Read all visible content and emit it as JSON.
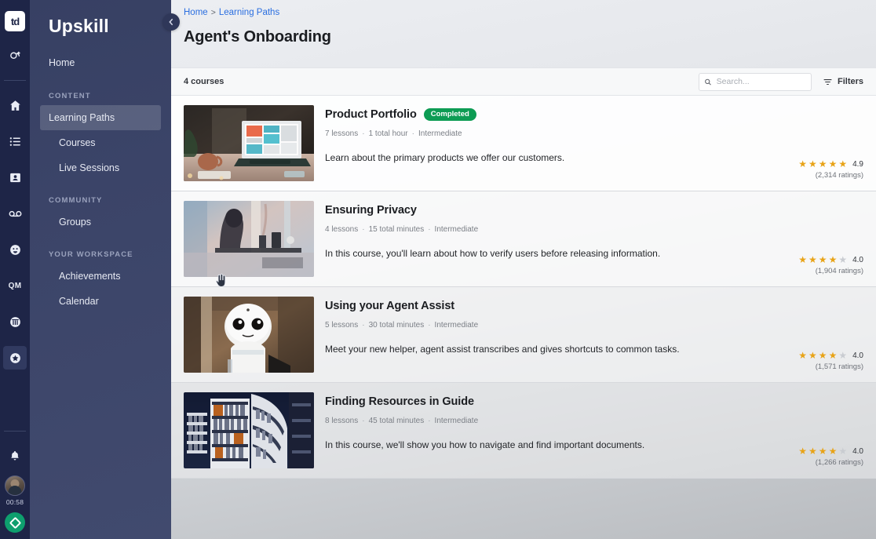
{
  "rail": {
    "logo_text": "td",
    "icons": [
      {
        "name": "messages-icon"
      },
      {
        "name": "home-icon"
      },
      {
        "name": "list-icon"
      },
      {
        "name": "contact-card-icon"
      },
      {
        "name": "voicemail-icon"
      },
      {
        "name": "smiley-icon"
      },
      {
        "name": "qm-icon",
        "label": "QM"
      },
      {
        "name": "building-icon"
      },
      {
        "name": "star-badge-icon"
      }
    ],
    "bell": "notifications-icon",
    "timer": "00:58",
    "status_icon": "diamond-icon"
  },
  "nav": {
    "brand": "Upskill",
    "home_label": "Home",
    "collapse_label": "‹",
    "groups": [
      {
        "title": "CONTENT",
        "items": [
          {
            "label": "Learning Paths",
            "active": true
          },
          {
            "label": "Courses",
            "active": false
          },
          {
            "label": "Live Sessions",
            "active": false
          }
        ]
      },
      {
        "title": "COMMUNITY",
        "items": [
          {
            "label": "Groups",
            "active": false
          }
        ]
      },
      {
        "title": "YOUR WORKSPACE",
        "items": [
          {
            "label": "Achievements",
            "active": false
          },
          {
            "label": "Calendar",
            "active": false
          }
        ]
      }
    ]
  },
  "header": {
    "breadcrumb": [
      {
        "label": "Home"
      },
      {
        "label": "Learning Paths"
      }
    ],
    "breadcrumb_separator": ">",
    "title": "Agent's Onboarding"
  },
  "listbar": {
    "count_label": "4 courses",
    "search_placeholder": "Search...",
    "search_value": "",
    "filters_label": "Filters"
  },
  "courses": [
    {
      "title": "Product Portfolio",
      "badge": "Completed",
      "lessons": "7 lessons",
      "duration": "1 total hour",
      "level": "Intermediate",
      "description": "Learn about the primary products we offer our customers.",
      "rating": "4.9",
      "stars_filled": 5,
      "ratings_count": "(2,314 ratings)",
      "thumb": "laptop-desk-photo"
    },
    {
      "title": "Ensuring Privacy",
      "badge": "",
      "lessons": "4 lessons",
      "duration": "15 total minutes",
      "level": "Intermediate",
      "description": "In this course, you'll learn about how to verify users before releasing information.",
      "rating": "4.0",
      "stars_filled": 4,
      "ratings_count": "(1,904 ratings)",
      "thumb": "person-window-photo"
    },
    {
      "title": "Using your Agent Assist",
      "badge": "",
      "lessons": "5 lessons",
      "duration": "30 total minutes",
      "level": "Intermediate",
      "description": "Meet your new helper, agent assist transcribes and gives shortcuts to common tasks.",
      "rating": "4.0",
      "stars_filled": 4,
      "ratings_count": "(1,571 ratings)",
      "thumb": "robot-photo"
    },
    {
      "title": "Finding Resources in Guide",
      "badge": "",
      "lessons": "8 lessons",
      "duration": "45 total minutes",
      "level": "Intermediate",
      "description": "In this course, we'll show you how to navigate and find important documents.",
      "rating": "4.0",
      "stars_filled": 4,
      "ratings_count": "(1,266 ratings)",
      "thumb": "library-shelves-photo"
    }
  ],
  "colors": {
    "rail_bg": "#1e2547",
    "nav_bg": "#3b4468",
    "accent_link": "#2a6ee0",
    "badge_green": "#0d9c54",
    "star_gold": "#e8a317",
    "status_green": "#0e9f6e"
  }
}
